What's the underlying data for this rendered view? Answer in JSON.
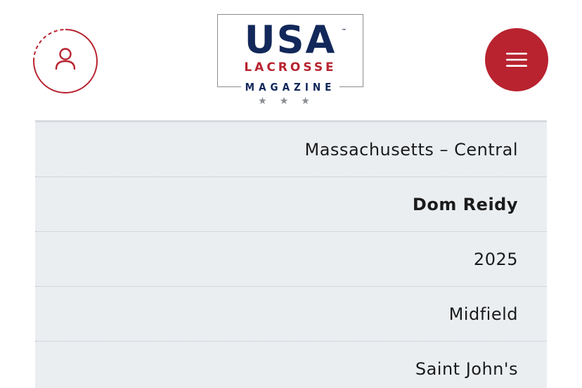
{
  "header": {
    "account_icon": "user-icon",
    "menu_icon": "hamburger-icon",
    "logo": {
      "line1": "USA",
      "trademark": "™",
      "line2": "LACROSSE",
      "line3": "MAGAZINE",
      "stars": "★★★"
    }
  },
  "player_details": {
    "rows": [
      {
        "value": "Massachusetts – Central",
        "bold": false
      },
      {
        "value": "Dom Reidy",
        "bold": true
      },
      {
        "value": "2025",
        "bold": false
      },
      {
        "value": "Midfield",
        "bold": false
      },
      {
        "value": "Saint John's",
        "bold": false
      }
    ]
  },
  "colors": {
    "brand_red": "#b8232f",
    "brand_navy": "#12285a",
    "table_bg": "#ebeef1"
  }
}
